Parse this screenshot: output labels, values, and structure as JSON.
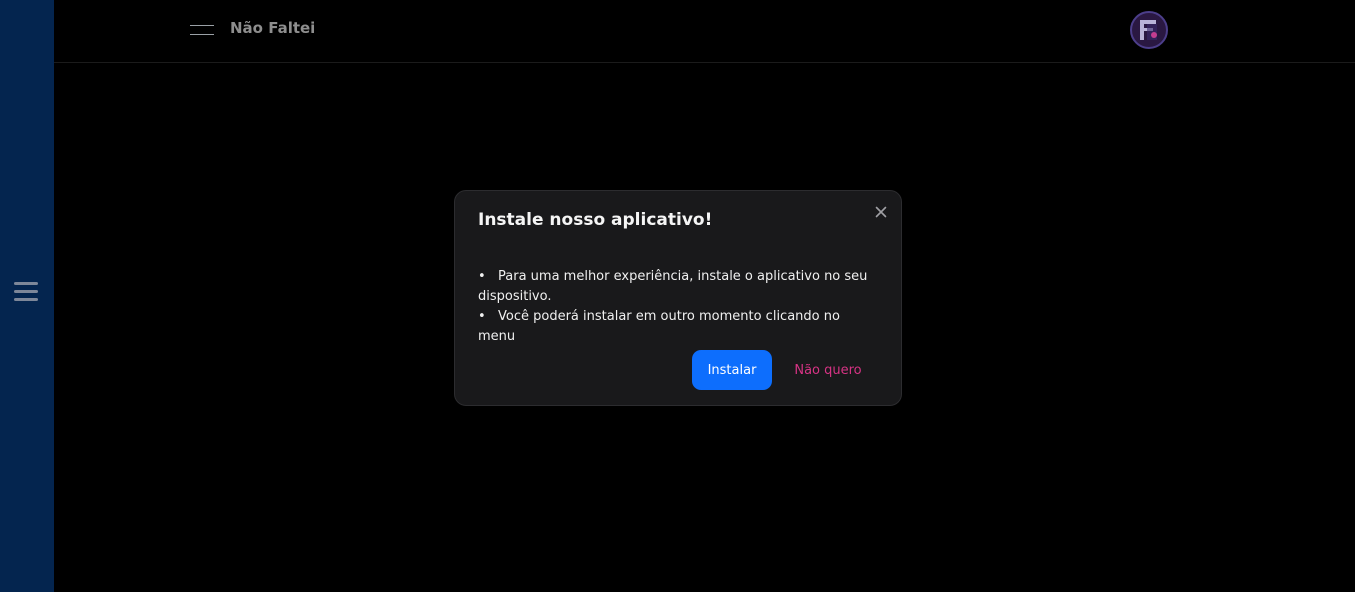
{
  "sidebar": {
    "menu_icon": "hamburger-icon"
  },
  "header": {
    "menu_icon": "menu-icon",
    "title": "Não Faltei",
    "avatar_icon": "user-avatar-icon"
  },
  "modal": {
    "title": "Instale nosso aplicativo!",
    "close_icon": "close-icon",
    "items": [
      "Para uma melhor experiência, instale o aplicativo no seu dispositivo.",
      "Você poderá instalar em outro momento clicando no menu"
    ],
    "install_label": "Instalar",
    "decline_label": "Não quero"
  },
  "colors": {
    "sidebar": "#04254f",
    "background": "#000000",
    "modal": "#19191b",
    "primary": "#0d6efd",
    "decline": "#d63384"
  }
}
